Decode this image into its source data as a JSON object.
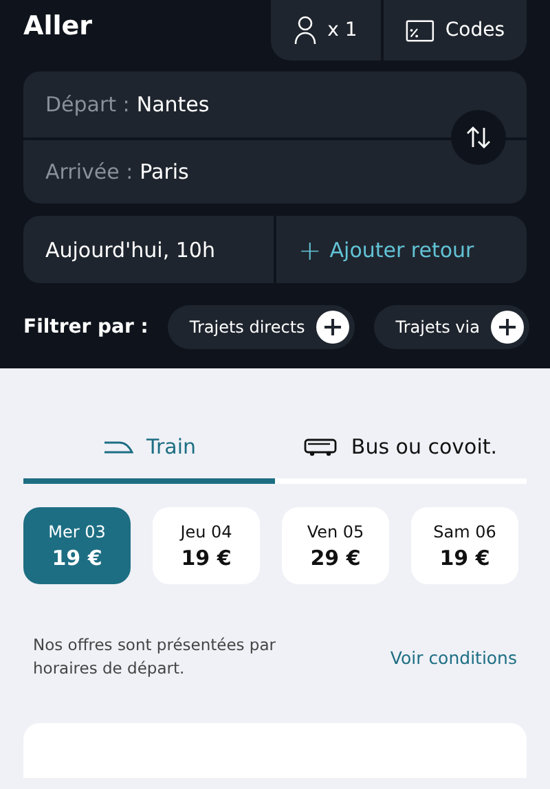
{
  "header": {
    "title": "Aller",
    "passengers": "x 1",
    "codes": "Codes"
  },
  "route": {
    "departure_label": "Départ :",
    "departure": "Nantes",
    "arrival_label": "Arrivée :",
    "arrival": "Paris"
  },
  "date": {
    "outbound": "Aujourd'hui, 10h",
    "return_label": "Ajouter retour",
    "return_icon": "+"
  },
  "filters": {
    "label": "Filtrer par :",
    "chips": [
      {
        "label": "Trajets directs"
      },
      {
        "label": "Trajets via"
      }
    ]
  },
  "tabs": [
    {
      "label": "Train",
      "selected": true,
      "kind": "train"
    },
    {
      "label": "Bus ou covoit.",
      "selected": false,
      "kind": "bus"
    }
  ],
  "days": [
    {
      "day": "Mer 03",
      "price": "19 €",
      "selected": true
    },
    {
      "day": "Jeu 04",
      "price": "19 €",
      "selected": false
    },
    {
      "day": "Ven 05",
      "price": "29 €",
      "selected": false
    },
    {
      "day": "Sam 06",
      "price": "19 €",
      "selected": false
    }
  ],
  "notice": {
    "text": "Nos offres sont présentées par horaires de départ.",
    "link": "Voir conditions"
  }
}
